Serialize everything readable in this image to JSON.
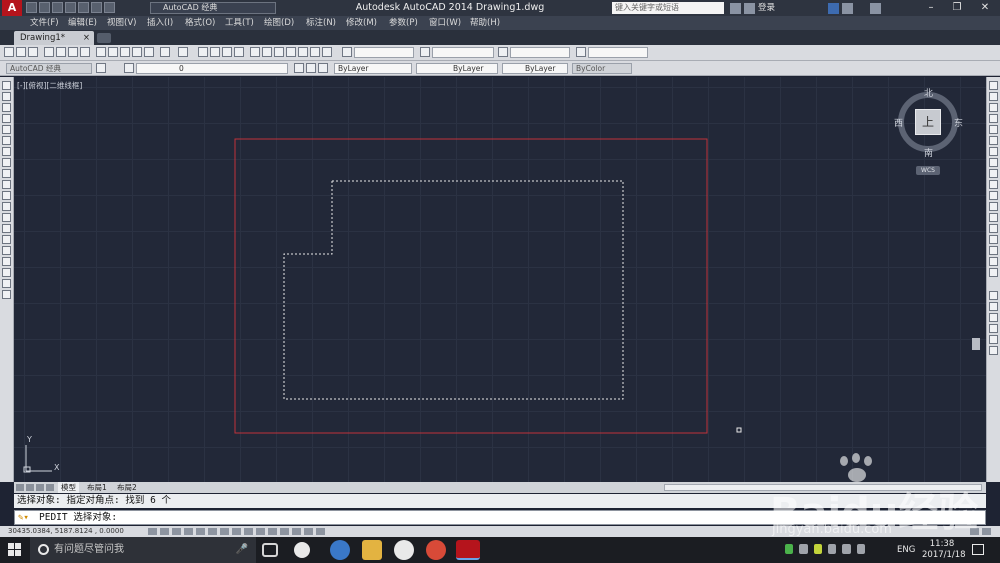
{
  "titlebar": {
    "workspace": "AutoCAD 经典",
    "title": "Autodesk AutoCAD 2014    Drawing1.dwg",
    "search_placeholder": "键入关键字或短语",
    "login": "登录",
    "logo_letter": "A"
  },
  "menu": [
    "文件(F)",
    "编辑(E)",
    "视图(V)",
    "插入(I)",
    "格式(O)",
    "工具(T)",
    "绘图(D)",
    "标注(N)",
    "修改(M)",
    "参数(P)",
    "窗口(W)",
    "帮助(H)"
  ],
  "tabs": {
    "document": "Drawing1*",
    "close": "×"
  },
  "toolbar2": {
    "workspace_combo": "AutoCAD 经典",
    "layer_combo": "0",
    "color_combo": "ByLayer",
    "linetype_combo": "ByLayer",
    "lineweight_combo": "ByLayer",
    "plotstyle_combo": "ByColor"
  },
  "viewport": {
    "label": "[-][俯视][二维线框]"
  },
  "viewcube": {
    "north": "北",
    "south": "南",
    "east": "东",
    "west": "西",
    "face": "上",
    "wcs": "WCS"
  },
  "ucs": {
    "x": "X",
    "y": "Y"
  },
  "layout_tabs": [
    {
      "label": "模型",
      "active": true
    },
    {
      "label": "布局1",
      "active": false
    },
    {
      "label": "布局2",
      "active": false
    }
  ],
  "command": {
    "history": "选择对象: 指定对角点: 找到 6 个",
    "prompt": "PEDIT 选择对象:"
  },
  "status": {
    "coords": "30435.0384, 5187.8124 , 0.0000"
  },
  "taskbar": {
    "search_placeholder": "有问题尽管问我",
    "lang": "ENG",
    "time": "11:38",
    "date": "2017/1/18"
  },
  "watermark": {
    "text": "Baidu经验",
    "url": "jingyan.baidu.com"
  },
  "colors": {
    "canvas": "#222838",
    "outer_rect": "#c0323a",
    "selection": "#e8e8e8",
    "accent": "#b5141c"
  }
}
